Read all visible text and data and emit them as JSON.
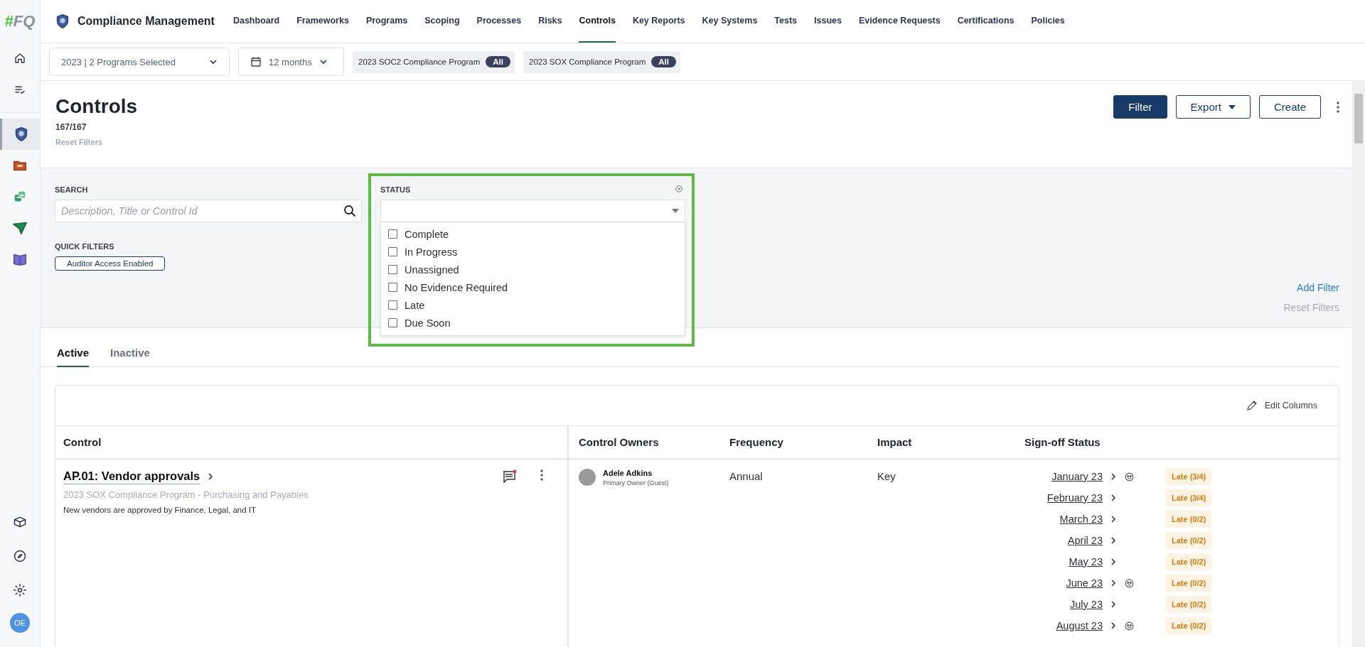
{
  "sidebar": {
    "logo": {
      "mark": "#",
      "text": "FQ"
    },
    "items": [
      {
        "selected": false
      },
      {
        "selected": false
      }
    ],
    "apps": [
      {
        "selected": true
      },
      {
        "selected": false
      },
      {
        "selected": false
      },
      {
        "selected": false
      },
      {
        "selected": false
      }
    ],
    "bottom": [
      {
        "selected": false
      },
      {
        "selected": false
      },
      {
        "selected": false
      }
    ],
    "avatar": "OE"
  },
  "nav": {
    "title": "Compliance Management",
    "items": [
      {
        "label": "Dashboard",
        "selected": false
      },
      {
        "label": "Frameworks",
        "selected": false
      },
      {
        "label": "Programs",
        "selected": false
      },
      {
        "label": "Scoping",
        "selected": false
      },
      {
        "label": "Processes",
        "selected": false
      },
      {
        "label": "Risks",
        "selected": false
      },
      {
        "label": "Controls",
        "selected": true
      },
      {
        "label": "Key Reports",
        "selected": false
      },
      {
        "label": "Key Systems",
        "selected": false
      },
      {
        "label": "Tests",
        "selected": false
      },
      {
        "label": "Issues",
        "selected": false
      },
      {
        "label": "Evidence Requests",
        "selected": false
      },
      {
        "label": "Certifications",
        "selected": false
      },
      {
        "label": "Policies",
        "selected": false
      }
    ]
  },
  "toolbar": {
    "program_select": "2023 | 2 Programs Selected",
    "period_select": "12 months",
    "chips": [
      {
        "label": "2023 SOC2 Compliance Program",
        "badge": "All"
      },
      {
        "label": "2023 SOX Compliance Program",
        "badge": "All"
      }
    ]
  },
  "header": {
    "title": "Controls",
    "count": "167/167",
    "reset": {
      "label": "Reset Filters",
      "disabled": true
    },
    "buttons": [
      {
        "label": "Filter",
        "kind": "primary"
      },
      {
        "label": "Export",
        "kind": "dropdown"
      },
      {
        "label": "Create",
        "kind": "outline"
      }
    ]
  },
  "filters": {
    "search": {
      "label": "SEARCH",
      "placeholder": "Description, Title or Control Id"
    },
    "quick_filters": {
      "label": "QUICK FILTERS",
      "chips": [
        "Auditor Access Enabled"
      ]
    },
    "status": {
      "label": "STATUS",
      "highlighted": true,
      "options": [
        {
          "label": "Complete",
          "checked": false
        },
        {
          "label": "In Progress",
          "checked": false
        },
        {
          "label": "Unassigned",
          "checked": false
        },
        {
          "label": "No Evidence Required",
          "checked": false
        },
        {
          "label": "Late",
          "checked": false
        },
        {
          "label": "Due Soon",
          "checked": false
        }
      ]
    },
    "add_filter": "Add Filter",
    "reset": {
      "label": "Reset Filters",
      "disabled": true
    }
  },
  "tabs": [
    {
      "label": "Active",
      "selected": true
    },
    {
      "label": "Inactive",
      "selected": false
    }
  ],
  "table": {
    "edit_columns": "Edit Columns",
    "columns": [
      "Control",
      "Control Owners",
      "Frequency",
      "Impact",
      "Sign-off Status"
    ],
    "rows": [
      {
        "title": "AP.01: Vendor approvals",
        "program": "2023 SOX Compliance Program - Purchasing and Payables",
        "description": "New vendors are approved by Finance, Legal, and IT",
        "has_notification": true,
        "owner": {
          "name": "Adele Adkins",
          "role": "Primary Owner (Guest)"
        },
        "frequency": "Annual",
        "impact": "Key",
        "signoffs": [
          {
            "period": "January 23",
            "has_icon": true,
            "status": "Late (3/4)"
          },
          {
            "period": "February 23",
            "has_icon": false,
            "status": "Late (3/4)"
          },
          {
            "period": "March 23",
            "has_icon": false,
            "status": "Late (0/2)"
          },
          {
            "period": "April 23",
            "has_icon": false,
            "status": "Late (0/2)"
          },
          {
            "period": "May 23",
            "has_icon": false,
            "status": "Late (0/2)"
          },
          {
            "period": "June 23",
            "has_icon": true,
            "status": "Late (0/2)"
          },
          {
            "period": "July 23",
            "has_icon": false,
            "status": "Late (0/2)"
          },
          {
            "period": "August 23",
            "has_icon": true,
            "status": "Late (0/2)"
          }
        ]
      }
    ]
  }
}
